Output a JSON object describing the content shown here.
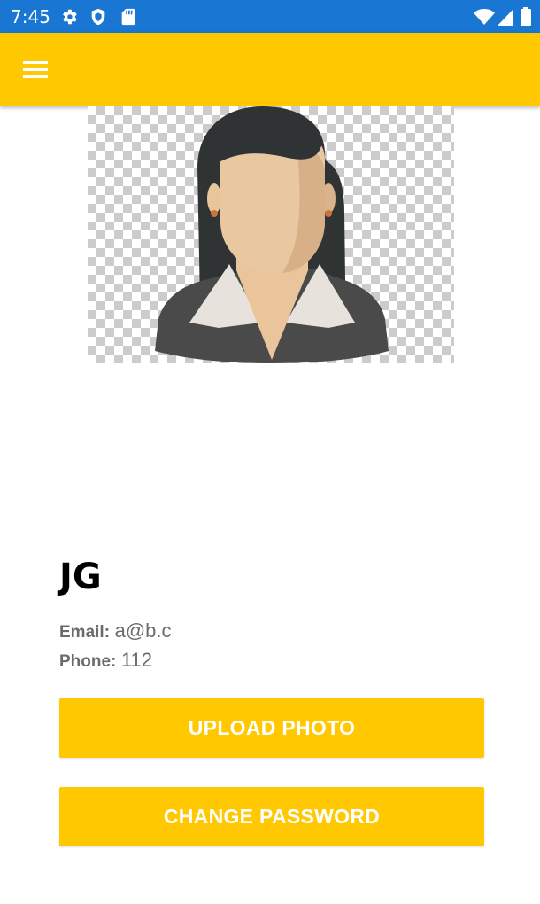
{
  "status_bar": {
    "time": "7:45",
    "left_icons": [
      "gear-icon",
      "shield-icon",
      "sd-card-icon"
    ],
    "right_icons": [
      "wifi-icon",
      "cell-signal-icon",
      "battery-icon"
    ],
    "color": "#1976d2"
  },
  "app_bar": {
    "menu_icon": "hamburger-menu-icon",
    "color": "#ffc800"
  },
  "profile": {
    "photo": "avatar-woman-placeholder",
    "name": "JG",
    "email_label": "Email:",
    "email_value": "a@b.c",
    "phone_label": "Phone:",
    "phone_value": "112"
  },
  "actions": {
    "upload_label": "UPLOAD PHOTO",
    "change_password_label": "CHANGE PASSWORD",
    "button_color": "#ffc800"
  }
}
